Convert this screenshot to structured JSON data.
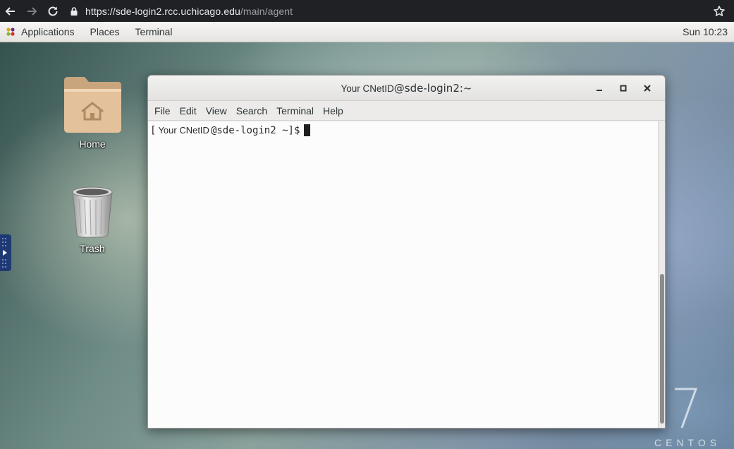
{
  "browser": {
    "url_host": "https://sde-login2.rcc.uchicago.edu",
    "url_path": "/main/agent"
  },
  "panel": {
    "applications": "Applications",
    "places": "Places",
    "terminal": "Terminal",
    "clock": "Sun 10:23"
  },
  "desktop": {
    "home_label": "Home",
    "trash_label": "Trash",
    "os_version": "7",
    "os_name": "CENTOS"
  },
  "terminal": {
    "title_user": "Your CNetID",
    "title_host": "@sde-login2:~",
    "menus": [
      "File",
      "Edit",
      "View",
      "Search",
      "Terminal",
      "Help"
    ],
    "prompt_open": "[",
    "prompt_user": "Your CNetID",
    "prompt_rest": "@sde-login2 ~]$"
  },
  "colors": {
    "browser_bg": "#202124",
    "terminal_bg": "#fcfcfc",
    "side_tab": "#1f3a73"
  }
}
